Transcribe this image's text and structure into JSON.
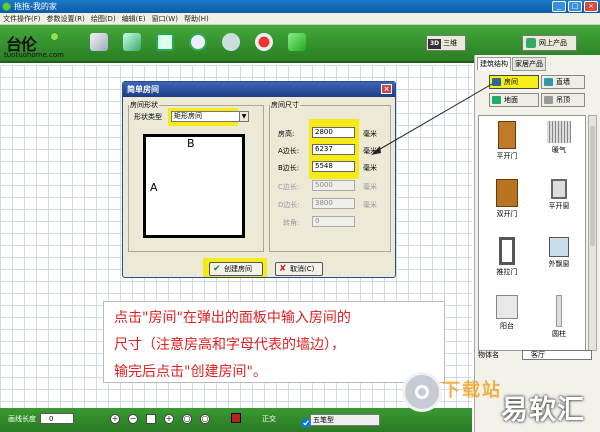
{
  "window": {
    "title": "拖拖-我的家"
  },
  "menu": [
    "文件操作(F)",
    "参数设置(R)",
    "绘图(D)",
    "编辑(E)",
    "窗口(W)",
    "帮助(H)"
  ],
  "logo": {
    "mark": "台伦",
    "url": "tuotuohome.com"
  },
  "toolbar": {
    "btn_3d": "三维",
    "btn_3d_badge": "3D",
    "btn_online": "网上产品",
    "icons": [
      "open-icon",
      "save-icon",
      "floppy-icon",
      "refresh-icon",
      "print-icon",
      "record-icon",
      "arrow-icon"
    ]
  },
  "panel": {
    "tabs": [
      "建筑结构",
      "家居产品"
    ],
    "buttons": {
      "room": "房间",
      "wall": "直墙",
      "floor": "地面",
      "ceiling": "吊顶"
    },
    "items": [
      "平开门",
      "暖气",
      "双开门",
      "平开窗",
      "推拉门",
      "外飘窗",
      "阳台",
      "圆柱"
    ],
    "object_name_label": "物体名",
    "object_name_value": "客厅"
  },
  "dialog": {
    "title": "简单房间",
    "group_shape": "房间形状",
    "shape_type_label": "形状类型",
    "shape_type_value": "矩形房间",
    "label_a": "A",
    "label_b": "B",
    "group_size": "房间尺寸",
    "height_label": "房高:",
    "height_value": "2800",
    "a_label": "A边长:",
    "a_value": "6237",
    "b_label": "B边长:",
    "b_value": "5548",
    "c_label": "C边长:",
    "c_value": "5000",
    "d_label": "D边长:",
    "d_value": "3800",
    "angle_label": "转角:",
    "angle_value": "0",
    "unit": "毫米",
    "create_btn": "创建房间",
    "cancel_btn": "取消(C)"
  },
  "callout": {
    "lines": [
      "点击\"房间\"在弹出的面板中输入房间的",
      "尺寸（注意房高和字母代表的墙边），",
      "输完后点击\"创建房间\"。"
    ]
  },
  "statusbar": {
    "wall_length_label": "画线长度",
    "wall_length_value": "0",
    "ortho_label": "正交",
    "ime_text": "五笔型"
  },
  "watermark": {
    "text": "易软汇",
    "faded": "下载站"
  },
  "colors": {
    "toolbar_green": "#2a7e24",
    "highlight_yellow": "#f6ea17",
    "callout_red": "#e02020"
  }
}
